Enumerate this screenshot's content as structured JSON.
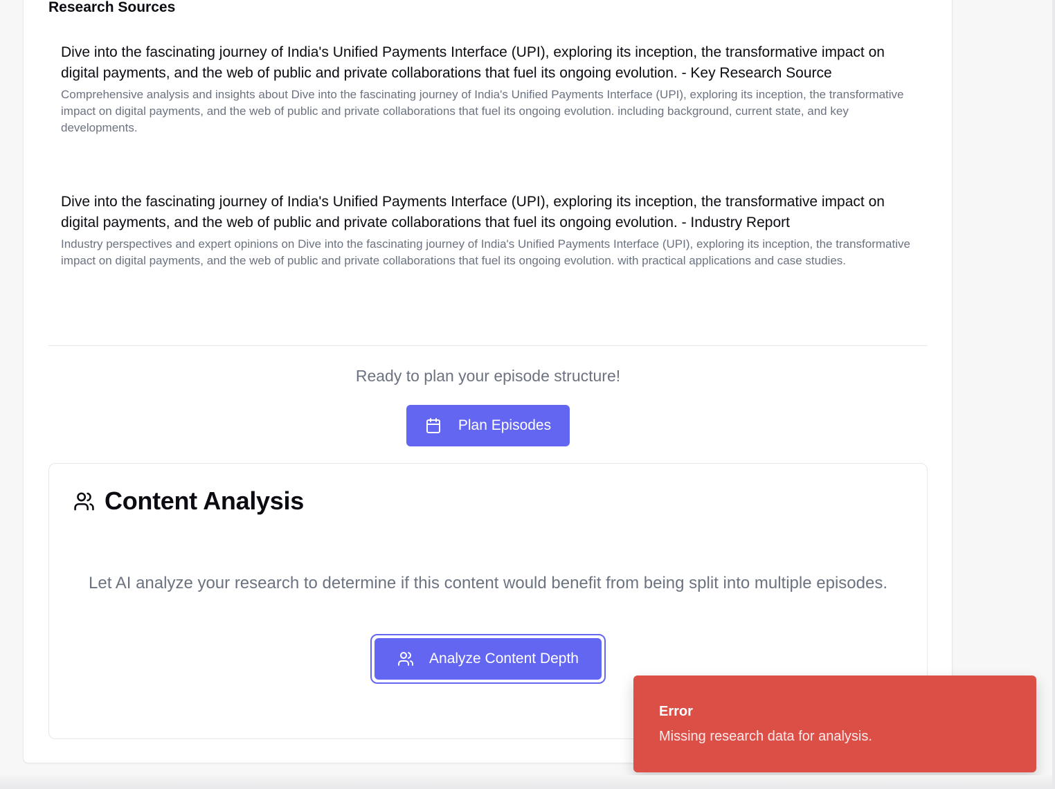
{
  "research_sources": {
    "heading": "Research Sources",
    "items": [
      {
        "title": "Dive into the fascinating journey of India's Unified Payments Interface (UPI), exploring its inception, the transformative impact on digital payments, and the web of public and private collaborations that fuel its ongoing evolution. - Key Research Source",
        "description": "Comprehensive analysis and insights about Dive into the fascinating journey of India's Unified Payments Interface (UPI), exploring its inception, the transformative impact on digital payments, and the web of public and private collaborations that fuel its ongoing evolution. including background, current state, and key developments."
      },
      {
        "title": "Dive into the fascinating journey of India's Unified Payments Interface (UPI), exploring its inception, the transformative impact on digital payments, and the web of public and private collaborations that fuel its ongoing evolution. - Industry Report",
        "description": "Industry perspectives and expert opinions on Dive into the fascinating journey of India's Unified Payments Interface (UPI), exploring its inception, the transformative impact on digital payments, and the web of public and private collaborations that fuel its ongoing evolution. with practical applications and case studies."
      }
    ]
  },
  "plan": {
    "ready_text": "Ready to plan your episode structure!",
    "button_label": "Plan Episodes",
    "button_icon": "calendar-icon"
  },
  "content_analysis": {
    "title": "Content Analysis",
    "title_icon": "users-icon",
    "description": "Let AI analyze your research to determine if this content would benefit from being split into multiple episodes.",
    "button_label": "Analyze Content Depth",
    "button_icon": "users-icon"
  },
  "toast": {
    "title": "Error",
    "message": "Missing research data for analysis."
  },
  "colors": {
    "accent": "#6366f1",
    "error": "#dc4f47",
    "muted_text": "#6b7280",
    "border": "#e5e7eb"
  }
}
